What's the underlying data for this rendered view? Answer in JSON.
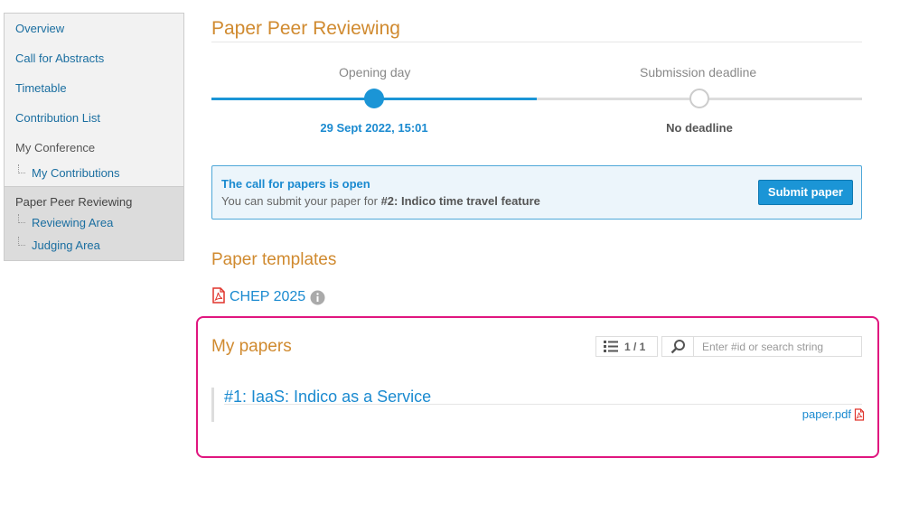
{
  "sidebar": {
    "items": [
      {
        "label": "Overview"
      },
      {
        "label": "Call for Abstracts"
      },
      {
        "label": "Timetable"
      },
      {
        "label": "Contribution List"
      },
      {
        "label": "My Conference"
      },
      {
        "label": "My Contributions"
      },
      {
        "label": "Paper Peer Reviewing"
      },
      {
        "label": "Reviewing Area"
      },
      {
        "label": "Judging Area"
      }
    ]
  },
  "page": {
    "title": "Paper Peer Reviewing"
  },
  "timeline": {
    "opening": {
      "label": "Opening day",
      "value": "29 Sept 2022, 15:01"
    },
    "deadline": {
      "label": "Submission deadline",
      "value": "No deadline"
    },
    "progress_percent": 50
  },
  "callout": {
    "title": "The call for papers is open",
    "text_prefix": "You can submit your paper for ",
    "text_bold": "#2: Indico time travel feature",
    "button_label": "Submit paper"
  },
  "templates": {
    "heading": "Paper templates",
    "items": [
      {
        "name": "CHEP 2025",
        "icon": "pdf-icon"
      }
    ]
  },
  "my_papers": {
    "heading": "My papers",
    "count_label": "1 / 1",
    "search_placeholder": "Enter #id or search string",
    "papers": [
      {
        "title": "#1: IaaS: Indico as a Service",
        "file": "paper.pdf"
      }
    ]
  },
  "colors": {
    "accent": "#1b95d6",
    "heading_orange": "#d08a2f",
    "link": "#1a8ad0",
    "highlight": "#e0167f",
    "pdf_red": "#e0342c"
  }
}
